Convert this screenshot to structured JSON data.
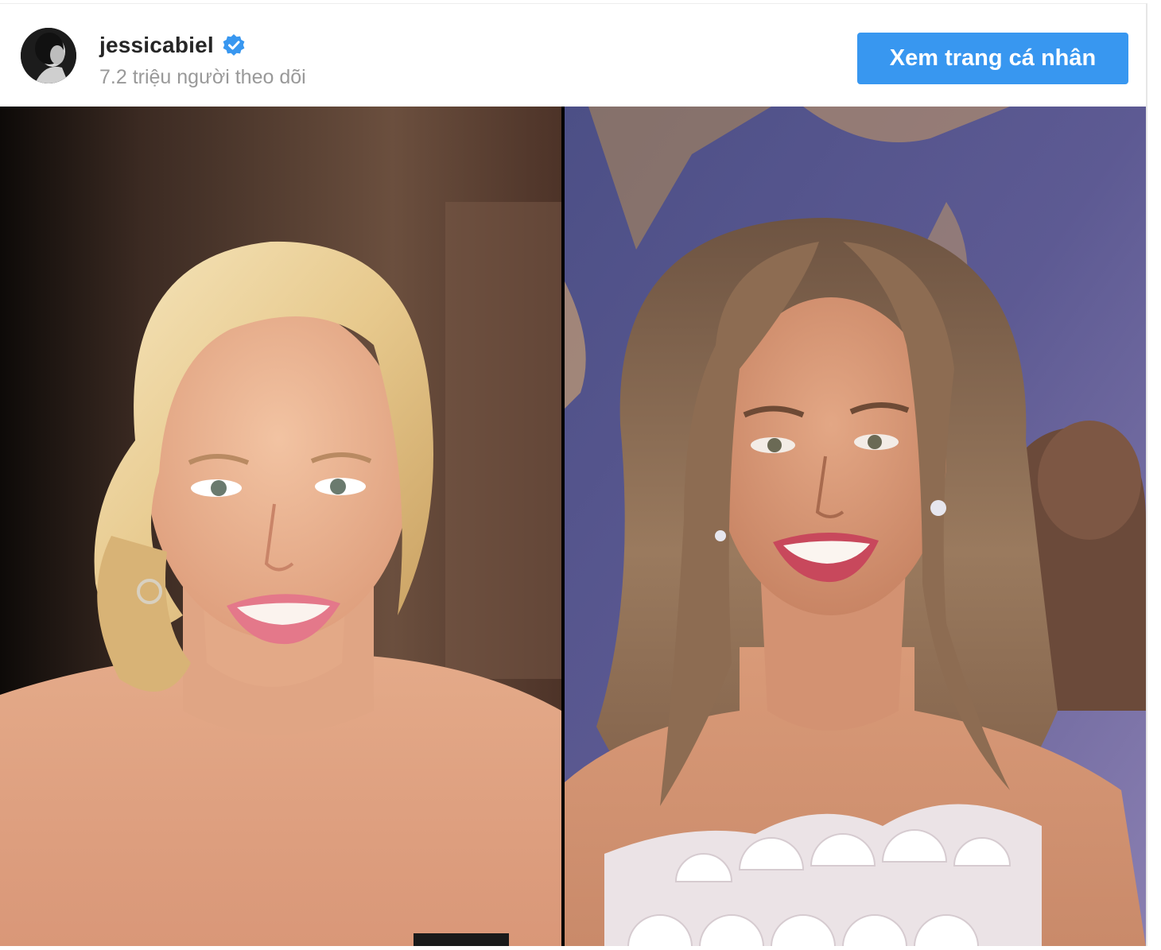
{
  "profile": {
    "username": "jessicabiel",
    "verified": true,
    "followers_text": "7.2 triệu người theo dõi",
    "view_profile_label": "Xem trang cá nhân"
  },
  "icons": {
    "verified": "verified-badge-icon",
    "avatar": "avatar-photo"
  },
  "colors": {
    "button": "#3897f0",
    "verified": "#3897f0",
    "username": "#262626",
    "followers": "#999999"
  },
  "post": {
    "photos": [
      {
        "name": "photo-left-blonde-portrait"
      },
      {
        "name": "photo-right-brunette-portrait"
      }
    ]
  }
}
